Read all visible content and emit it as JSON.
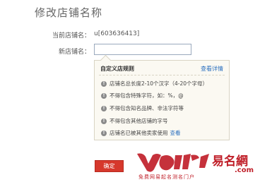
{
  "page": {
    "title": "修改店铺名称"
  },
  "form": {
    "current_label": "当前店铺名：",
    "current_value": "u[603636413]",
    "new_label": "新店铺名：",
    "new_value": ""
  },
  "rules": {
    "header": "自定义店规则",
    "link": "查看详情",
    "items": [
      {
        "text": "店铺名总长度2-10个汉字（4-20个字母）",
        "link": ""
      },
      {
        "text": "不得包含特殊字符，如：%，@",
        "link": ""
      },
      {
        "text": "不得包含知名品牌、非法字符等",
        "link": ""
      },
      {
        "text": "不得包含其他店铺的字号",
        "link": ""
      },
      {
        "text": "店铺名已被其他卖家使用",
        "link": "查看"
      }
    ]
  },
  "actions": {
    "confirm_label": "确定"
  },
  "watermark": {
    "brand": "易名網",
    "domain": ".com",
    "slogan": "免费网易起名测名门户"
  },
  "colors": {
    "accent_red": "#d6382c",
    "link_blue": "#2a6fbf",
    "box_bg": "#fbf9f2"
  }
}
